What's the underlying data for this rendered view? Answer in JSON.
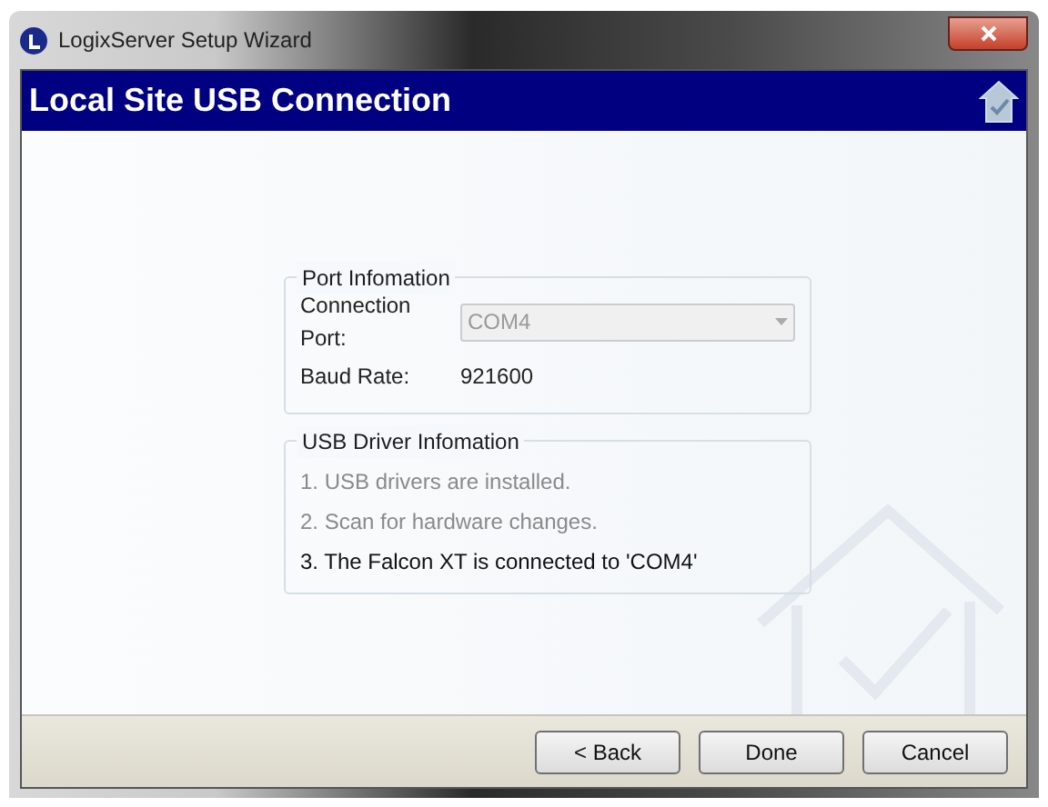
{
  "window": {
    "title": "LogixServer Setup Wizard"
  },
  "header": {
    "title": "Local Site USB Connection"
  },
  "port_group": {
    "title": "Port Infomation",
    "connection_port": {
      "label": "Connection Port:",
      "value": "COM4",
      "disabled": true
    },
    "baud_rate": {
      "label": "Baud Rate:",
      "value": "921600"
    }
  },
  "driver_group": {
    "title": "USB Driver Infomation",
    "steps": [
      {
        "text": "1. USB drivers are installed.",
        "dimmed": true
      },
      {
        "text": "2. Scan for hardware changes.",
        "dimmed": true
      },
      {
        "text": "3. The Falcon XT is connected to 'COM4'",
        "dimmed": false
      }
    ]
  },
  "buttons": [
    {
      "label": "< Back"
    },
    {
      "label": "Done"
    },
    {
      "label": "Cancel"
    }
  ]
}
